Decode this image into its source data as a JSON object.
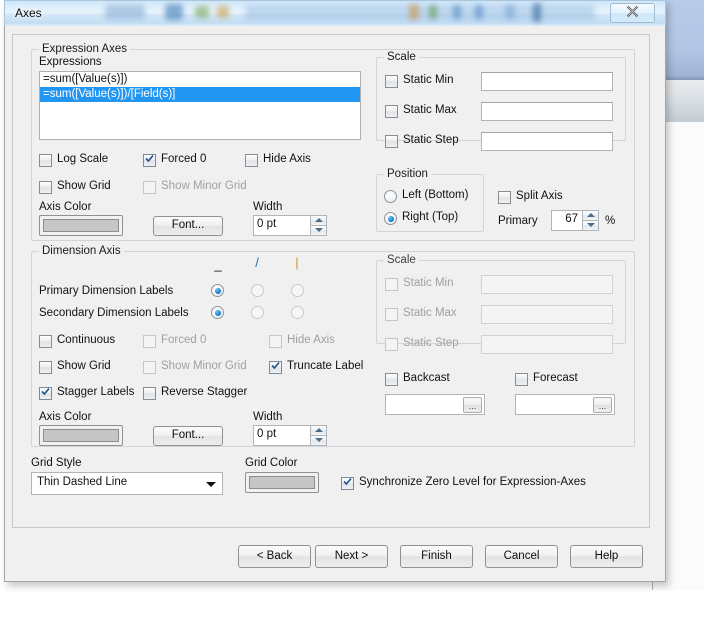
{
  "window": {
    "title": "Axes",
    "close_label": "✖"
  },
  "expression_axes": {
    "legend": "Expression Axes",
    "expressions_label": "Expressions",
    "expressions": [
      {
        "text": "=sum([Value(s)])",
        "selected": false
      },
      {
        "text": "=sum([Value(s)])/[Field(s)]",
        "selected": true
      }
    ],
    "log_scale": "Log Scale",
    "forced_0": "Forced 0",
    "hide_axis": "Hide Axis",
    "show_grid": "Show Grid",
    "show_minor_grid": "Show Minor Grid",
    "axis_color_label": "Axis Color",
    "font_button": "Font...",
    "width_label": "Width",
    "width_value": "0 pt",
    "scale": {
      "legend": "Scale",
      "static_min": "Static Min",
      "static_max": "Static Max",
      "static_step": "Static Step",
      "static_min_value": "",
      "static_max_value": "",
      "static_step_value": ""
    },
    "position": {
      "legend": "Position",
      "left_bottom": "Left (Bottom)",
      "right_top": "Right (Top)",
      "selected": "right_top"
    },
    "split_axis": "Split Axis",
    "primary_label": "Primary",
    "primary_value": "67",
    "percent_sign": "%"
  },
  "dimension_axis": {
    "legend": "Dimension Axis",
    "orientation_headers": [
      "_",
      "/",
      "|"
    ],
    "primary_dimension_labels": "Primary Dimension Labels",
    "secondary_dimension_labels": "Secondary Dimension Labels",
    "primary_selected_index": 0,
    "secondary_selected_index": 0,
    "continuous": "Continuous",
    "forced_0": "Forced 0",
    "hide_axis": "Hide Axis",
    "show_grid": "Show Grid",
    "show_minor_grid": "Show Minor Grid",
    "truncate_label": "Truncate Label",
    "stagger_labels": "Stagger Labels",
    "reverse_stagger": "Reverse Stagger",
    "axis_color_label": "Axis Color",
    "font_button": "Font...",
    "width_label": "Width",
    "width_value": "0 pt",
    "scale": {
      "legend": "Scale",
      "static_min": "Static Min",
      "static_max": "Static Max",
      "static_step": "Static Step",
      "static_min_value": "",
      "static_max_value": "",
      "static_step_value": ""
    },
    "backcast": "Backcast",
    "forecast": "Forecast",
    "backcast_value": "",
    "forecast_value": "",
    "browse_glyph": "..."
  },
  "grid": {
    "style_label": "Grid Style",
    "style_value": "Thin Dashed Line",
    "color_label": "Grid Color",
    "sync_zero": "Synchronize Zero Level for Expression-Axes"
  },
  "buttons": {
    "back": "< Back",
    "next": "Next >",
    "finish": "Finish",
    "cancel": "Cancel",
    "help": "Help"
  },
  "colors": {
    "accent_selection": "#2196f3",
    "swatch_gray": "#c6c6c6",
    "dialog_face": "#f0f0f0"
  }
}
